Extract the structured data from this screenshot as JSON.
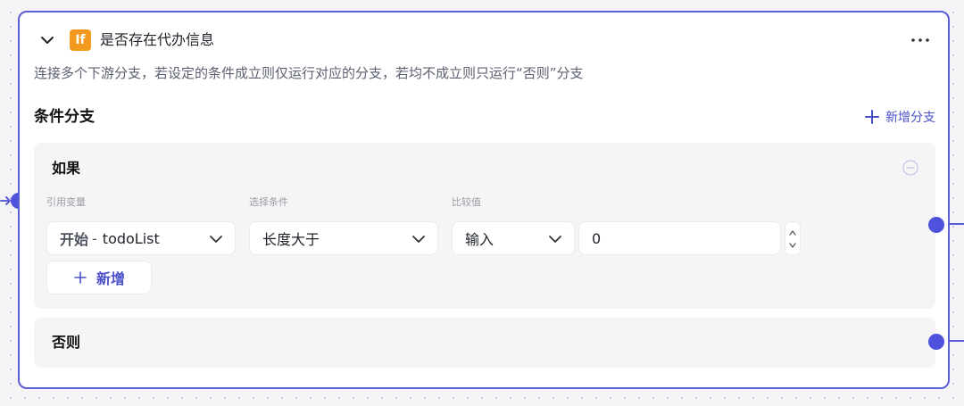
{
  "node": {
    "icon_text": "If",
    "title": "是否存在代办信息",
    "description": "连接多个下游分支，若设定的条件成立则仅运行对应的分支，若均不成立则只运行“否则”分支",
    "section_title": "条件分支",
    "add_branch_label": "新增分支"
  },
  "branch_if": {
    "title": "如果",
    "labels": {
      "variable": "引用变量",
      "condition": "选择条件",
      "compare": "比较值"
    },
    "variable": {
      "source": "开始",
      "separator": "-",
      "name": "todoList"
    },
    "condition": "长度大于",
    "compare_type": "输入",
    "compare_value": "0",
    "add_label": "新增"
  },
  "branch_else": {
    "title": "否则"
  },
  "icons": [
    "chevron-down-icon",
    "if-icon",
    "more-icon",
    "plus-icon",
    "minus-circle-icon",
    "chevron-up-icon",
    "input-port-arrow-icon"
  ],
  "colors": {
    "accent": "#5b5fd6",
    "port": "#4f52dc",
    "if_icon_bg": "#f29a1d",
    "link": "#4a50c8"
  }
}
